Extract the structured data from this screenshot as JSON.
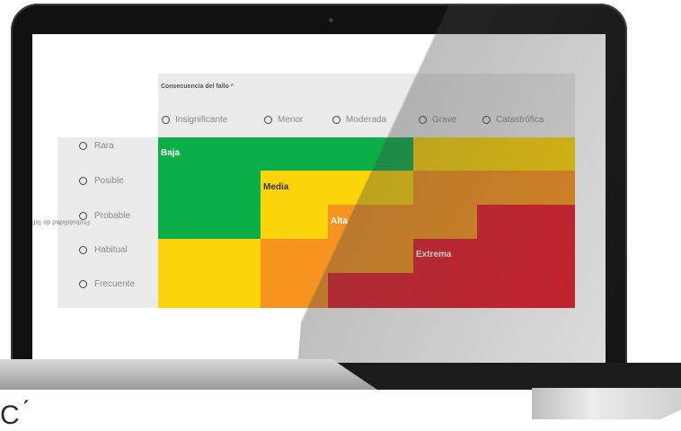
{
  "matrix": {
    "consequence_label": "Consecuencia del fallo",
    "probability_label": "Probabilidad de fallo",
    "required_mark": "*",
    "columns": [
      "Insignificante",
      "Menor",
      "Moderada",
      "Grave",
      "Catastrófica"
    ],
    "rows": [
      "Rara",
      "Posible",
      "Probable",
      "Habitual",
      "Frecuente"
    ],
    "zones": {
      "low": "Baja",
      "medium": "Media",
      "high": "Alta",
      "extreme": "Extrema"
    },
    "colors": {
      "low": "#0aaf48",
      "medium": "#fcd40a",
      "high": "#f7941f",
      "extreme": "#e41e2b"
    }
  },
  "background_text": "C                              ́"
}
